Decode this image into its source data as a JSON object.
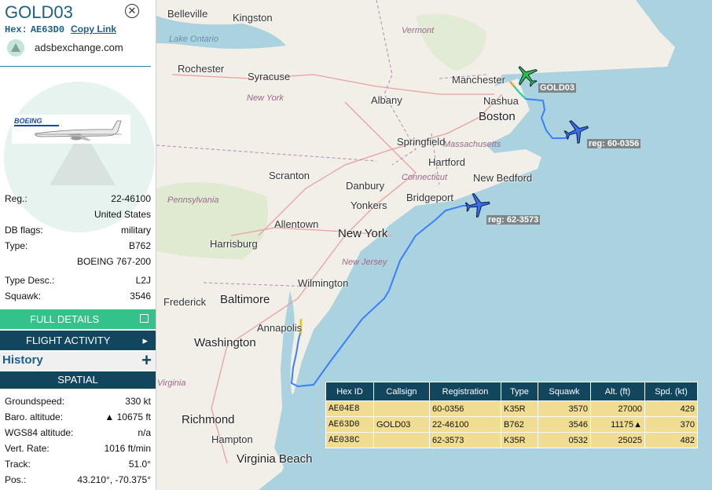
{
  "header": {
    "callsign": "GOLD03",
    "hex_label": "Hex:",
    "hex": "AE63D0",
    "copy_link": "Copy Link",
    "source": "adsbexchange.com"
  },
  "details": [
    {
      "key": "Reg.:",
      "value": "22-46100"
    },
    {
      "key": "",
      "value": "United States"
    },
    {
      "key": "DB flags:",
      "value": "military"
    },
    {
      "key": "Type:",
      "value": "B762"
    },
    {
      "key": "",
      "value": "BOEING 767-200"
    },
    {
      "key": "Type Desc.:",
      "value": "L2J"
    },
    {
      "key": "Squawk:",
      "value": "3546"
    }
  ],
  "buttons": {
    "full_details": "FULL DETAILS",
    "flight_activity": "FLIGHT ACTIVITY",
    "history": "History",
    "spatial": "SPATIAL"
  },
  "spatial": [
    {
      "key": "Groundspeed:",
      "value": "330 kt"
    },
    {
      "key": "Baro. altitude:",
      "value": "▲ 10675 ft"
    },
    {
      "key": "WGS84 altitude:",
      "value": "n/a"
    },
    {
      "key": "Vert. Rate:",
      "value": "1016 ft/min"
    },
    {
      "key": "Track:",
      "value": "51.0°"
    },
    {
      "key": "Pos.:",
      "value": "43.210°, -70.375°"
    }
  ],
  "map": {
    "cities": [
      "Belleville",
      "Kingston",
      "Rochester",
      "Syracuse",
      "Albany",
      "Manchester",
      "Nashua",
      "Boston",
      "Springfield",
      "Hartford",
      "Scranton",
      "Danbury",
      "Bridgeport",
      "Yonkers",
      "New York",
      "New Bedford",
      "Allentown",
      "Harrisburg",
      "Wilmington",
      "Frederick",
      "Baltimore",
      "Annapolis",
      "Washington",
      "Richmond",
      "Hampton",
      "Virginia Beach"
    ],
    "states": [
      "Vermont",
      "New York",
      "Massachusetts",
      "Connecticut",
      "Pennsylvania",
      "New Jersey",
      "Virginia"
    ],
    "water": "Lake Ontario",
    "aircraft_tags": [
      "GOLD03",
      "reg: 60-0356",
      "reg: 62-3573"
    ]
  },
  "table": {
    "headers": [
      "Hex ID",
      "Callsign",
      "Registration",
      "Type",
      "Squawk",
      "Alt. (ft)",
      "Spd. (kt)"
    ],
    "rows": [
      [
        "AE04E8",
        "",
        "60-0356",
        "K35R",
        "3570",
        "27000",
        "429"
      ],
      [
        "AE63D0",
        "GOLD03",
        "22-46100",
        "B762",
        "3546",
        "11175▲",
        "370"
      ],
      [
        "AE038C",
        "",
        "62-3573",
        "K35R",
        "0532",
        "25025",
        "482"
      ]
    ]
  },
  "colors": {
    "header_blue": "#1f5e86",
    "navy": "#12465f",
    "green": "#33c28a",
    "table_row": "#f1dd91",
    "water": "#aad3df"
  }
}
